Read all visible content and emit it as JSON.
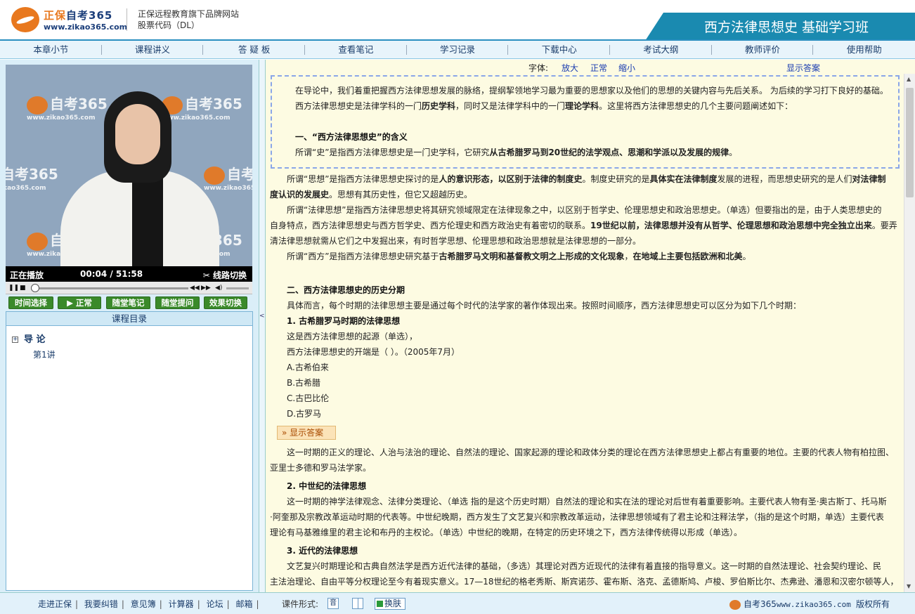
{
  "header": {
    "logo_prefix": "正保",
    "logo_brand": "自考365",
    "logo_url": "www.zikao365.com",
    "tagline_line1": "正保远程教育旗下品牌网站",
    "tagline_line2": "股票代码（DL）",
    "course_title": "西方法律思想史 基础学习班"
  },
  "nav": [
    "本章小节",
    "课程讲义",
    "答 疑 板",
    "查看笔记",
    "学习记录",
    "下载中心",
    "考试大纲",
    "教师评价",
    "使用帮助"
  ],
  "video": {
    "watermark_text": "自考365",
    "watermark_url": "www.zikao365.com",
    "status": "正在播放",
    "time": "00:04 / 51:58",
    "switch_label": "线路切换",
    "progress": 0.0
  },
  "green_buttons": [
    "时间选择",
    "正常",
    "随堂笔记",
    "随堂提问",
    "效果切换"
  ],
  "catalog": {
    "title": "课程目录",
    "chapter": "导 论",
    "lecture": "第1讲"
  },
  "fontbar": {
    "label": "字体:",
    "enlarge": "放大",
    "normal": "正常",
    "shrink": "缩小",
    "show_answer": "显示答案"
  },
  "content": {
    "p1a": "在导论中，我们着重把握西方法律思想发展的脉络，提纲挈领地学习最为重要的思想家以及他们的思想的关键内容与先后关系。 为后续的学习打下良好的基础。",
    "p1b": "西方法律思想史是法律学科的一门",
    "p1b_b1": "历史学科",
    "p1b_2": "，同时又是法律学科中的一门",
    "p1b_b2": "理论学科",
    "p1b_3": "。这里将西方法律思想史的几个主要问题阐述如下：",
    "h1": "一、“西方法律思想史”的含义",
    "p2a": "所谓“史”是指西方法律思想史是一门史学科，它研究",
    "p2a_b": "从古希腊罗马到20世纪的法学观点、思潮和学派以及发展的规律",
    "p2a_end": "。",
    "p3a": "所谓“思想”是指西方法律思想史探讨的是",
    "p3a_b1": "人的意识形态，以区别于法律的制度史",
    "p3a_2": "。制度史研究的是",
    "p3a_b2": "具体实在法律制度",
    "p3a_3": "发展的进程，而思想史研究的是人们",
    "p3a_b3": "对法律制",
    "p3b_b": "度认识的发展史",
    "p3b": "。思想有其历史性，但它又超越历史。",
    "p4a": "所谓“法律思想”是指西方法律思想史将其研究领域限定在法律现象之中，以区别于哲学史、伦理思想史和政治思想史。（单选）但要指出的是，由于人类思想史的",
    "p4b": "自身特点，西方法律思想史与西方哲学史、西方伦理史和西方政治史有着密切的联系。",
    "p4b_b": "19世纪以前，法律思想并没有从哲学、伦理思想和政治思想中完全独立出来",
    "p4b_2": "。要弄",
    "p4c": "清法律思想就需从它们之中发掘出来，有时哲学思想、伦理思想和政治思想就是法律思想的一部分。",
    "p5a": "所谓“西方”是指西方法律思想史研究基于",
    "p5a_b1": "古希腊罗马文明和基督教文明之上形成的文化现象",
    "p5a_2": "，",
    "p5a_b2": "在地域上主要包括欧洲和北美",
    "p5a_3": "。",
    "h2": "二、西方法律思想史的历史分期",
    "p6": "具体而言，每个时期的法律思想主要是通过每个时代的法学家的著作体现出来。按照时间顺序，西方法律思想史可以区分为如下几个时期：",
    "h3": "1. 古希腊罗马时期的法律思想",
    "p7": "这是西方法律思想的起源（单选），",
    "q1": "西方法律思想史的开端是（  ）。（2005年7月）",
    "opt_a": "A.古希伯来",
    "opt_b": "B.古希腊",
    "opt_c": "C.古巴比伦",
    "opt_d": "D.古罗马",
    "show_answer_btn": "显示答案",
    "p8a": "这一时期的正义的理论、人治与法治的理论、自然法的理论、国家起源的理论和政体分类的理论在西方法律思想史上都占有重要的地位。主要的代表人物有柏拉图、",
    "p8b": "亚里士多德和罗马法学家。",
    "h4": "2. 中世纪的法律思想",
    "p9a": "这一时期的神学法律观念、法律分类理论、（单选 指的是这个历史时期）自然法的理论和实在法的理论对后世有着重要影响。主要代表人物有圣·奥古斯丁、托马斯",
    "p9b": "·阿奎那及宗教改革运动时期的代表等。中世纪晚期，西方发生了文艺复兴和宗教改革运动，法律思想领域有了君主论和注释法学，（指的是这个时期，单选）主要代表",
    "p9c": "理论有马基雅维里的君主论和布丹的主权论。（单选）中世纪的晚期，在特定的历史环境之下，西方法律传统得以形成（单选）。",
    "h5": "3. 近代的法律思想",
    "p10a": "文艺复兴时期理论和古典自然法学是西方近代法律的基础，（多选）其理论对西方近现代的法律有着直接的指导意义。这一时期的自然法理论、社会契约理论、民",
    "p10b": "主法治理论、自由平等分权理论至今有着现实意义。17—18世纪的格老秀斯、斯宾诺莎、霍布斯、洛克、孟德斯鸠、卢梭、罗伯斯比尔、杰弗逊、潘恩和汉密尔顿等人，"
  },
  "footer": {
    "links": [
      "走进正保",
      "我要纠错",
      "意见簿",
      "计算器",
      "论坛",
      "邮箱"
    ],
    "courseware_label": "课件形式:",
    "cw_audio": "音",
    "skin_label": "换肤",
    "brand": "自考365",
    "brand_url": "www.zikao365.com",
    "copyright": "版权所有"
  },
  "colors": {
    "accent_blue": "#1a8ab0",
    "logo_orange": "#e8781e",
    "button_green": "#3a8a2a",
    "content_bg": "#fdfbe2"
  }
}
